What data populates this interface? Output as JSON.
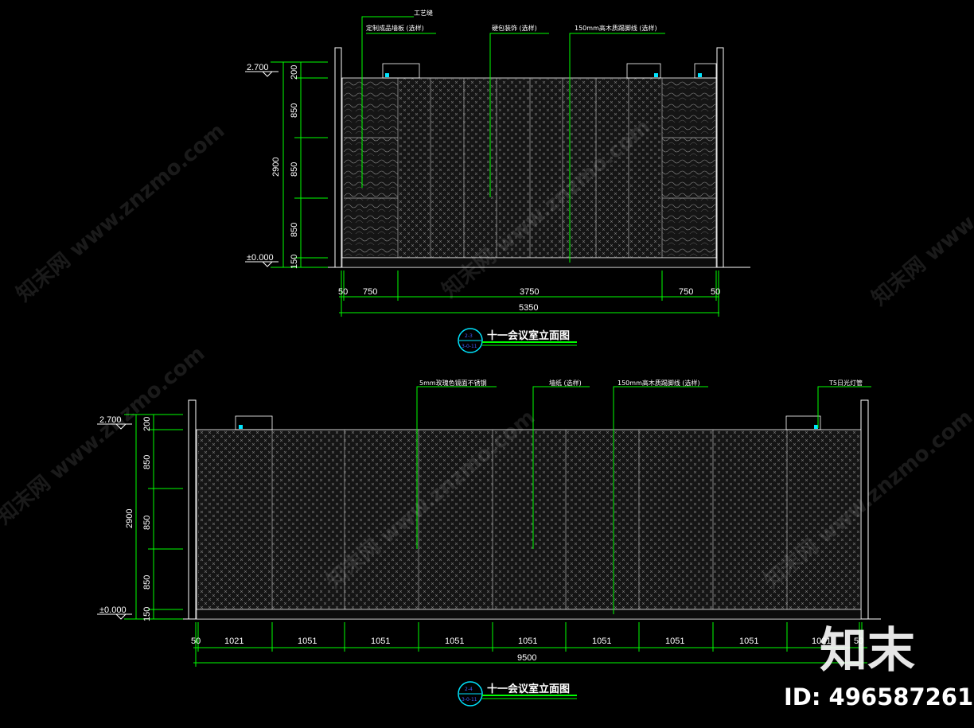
{
  "elev1": {
    "level_top": "2.700",
    "level_bottom": "±0.000",
    "dim_total_h": "2900",
    "dim_h": [
      "200",
      "850",
      "850",
      "850",
      "150"
    ],
    "dim_w": [
      "50",
      "750",
      "3750",
      "750",
      "50"
    ],
    "dim_total_w": "5350",
    "labels": [
      "工艺缝",
      "定制成品墙板 (选样)",
      "硬包装饰 (选样)",
      "150mm高木质踢脚线 (选样)"
    ],
    "title": "十一会议室立面图",
    "tag_top": "2-3",
    "tag_bottom": "3-0-11"
  },
  "elev2": {
    "level_top": "2.700",
    "level_bottom": "±0.000",
    "dim_total_h": "2900",
    "dim_h": [
      "200",
      "850",
      "850",
      "850",
      "150"
    ],
    "dim_w": [
      "50",
      "1021",
      "1051",
      "1051",
      "1051",
      "1051",
      "1051",
      "1051",
      "1051",
      "1021",
      "50"
    ],
    "dim_total_w": "9500",
    "labels": [
      "5mm玫瑰色镜面不锈钢",
      "墙纸 (选样)",
      "150mm高木质踢脚线 (选样)",
      "T5日光灯管"
    ],
    "title": "十一会议室立面图",
    "tag_top": "2-4",
    "tag_bottom": "3-0-11"
  },
  "watermark": {
    "brand": "知末网 www.znzmo.com"
  },
  "branding": {
    "logo": "知末",
    "id": "ID: 496587261"
  },
  "colors": {
    "dim": "#00ff00",
    "line": "#ffffff",
    "leader": "#00ff00",
    "panel": "#1a1a1a",
    "pattern": "#6a6a6a",
    "cyan": "#00e5ff",
    "blue": "#0000ff"
  }
}
